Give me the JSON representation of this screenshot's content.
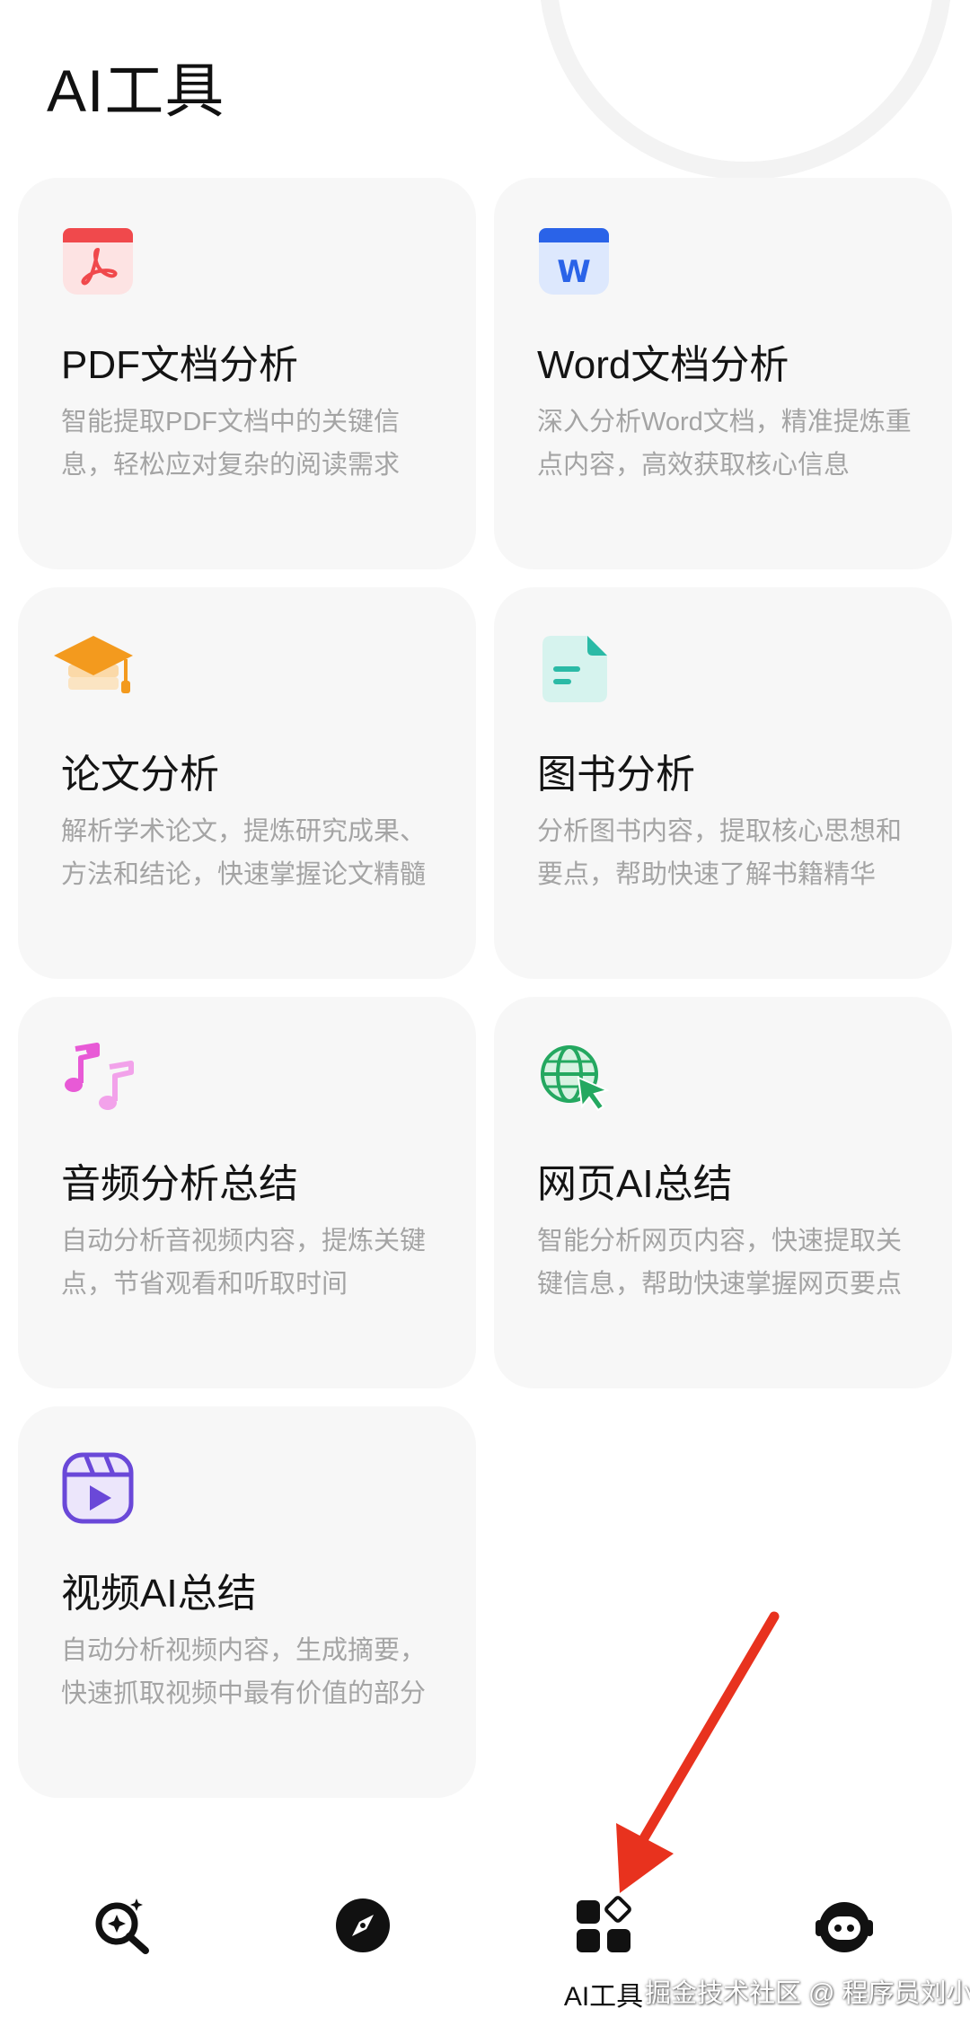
{
  "header": {
    "title": "AI工具"
  },
  "cards": [
    {
      "title": "PDF文档分析",
      "desc": "智能提取PDF文档中的关键信息，轻松应对复杂的阅读需求",
      "icon": "pdf-icon",
      "color": "#f0494c"
    },
    {
      "title": "Word文档分析",
      "desc": "深入分析Word文档，精准提炼重点内容，高效获取核心信息",
      "icon": "word-icon",
      "color": "#2a63e8"
    },
    {
      "title": "论文分析",
      "desc": "解析学术论文，提炼研究成果、方法和结论，快速掌握论文精髓",
      "icon": "graduation-cap-icon",
      "color": "#f39a1e"
    },
    {
      "title": "图书分析",
      "desc": "分析图书内容，提取核心思想和要点，帮助快速了解书籍精华",
      "icon": "document-icon",
      "color": "#2bbaa6"
    },
    {
      "title": "音频分析总结",
      "desc": "自动分析音视频内容，提炼关键点，节省观看和听取时间",
      "icon": "music-note-icon",
      "color": "#e85ad6"
    },
    {
      "title": "网页AI总结",
      "desc": "智能分析网页内容，快速提取关键信息，帮助快速掌握网页要点",
      "icon": "globe-cursor-icon",
      "color": "#24a860"
    },
    {
      "title": "视频AI总结",
      "desc": "自动分析视频内容，生成摘要，快速抓取视频中最有价值的部分",
      "icon": "video-play-icon",
      "color": "#6a48d8"
    }
  ],
  "tabbar": {
    "items": [
      {
        "label": "",
        "icon": "sparkle-search-icon"
      },
      {
        "label": "",
        "icon": "compass-icon"
      },
      {
        "label": "AI工具",
        "icon": "apps-grid-icon"
      },
      {
        "label": "",
        "icon": "robot-icon"
      }
    ]
  },
  "annotation": {
    "arrow_color": "#e8321e"
  },
  "watermark": {
    "text": "掘金技术社区 @ 程序员刘小鹿"
  }
}
